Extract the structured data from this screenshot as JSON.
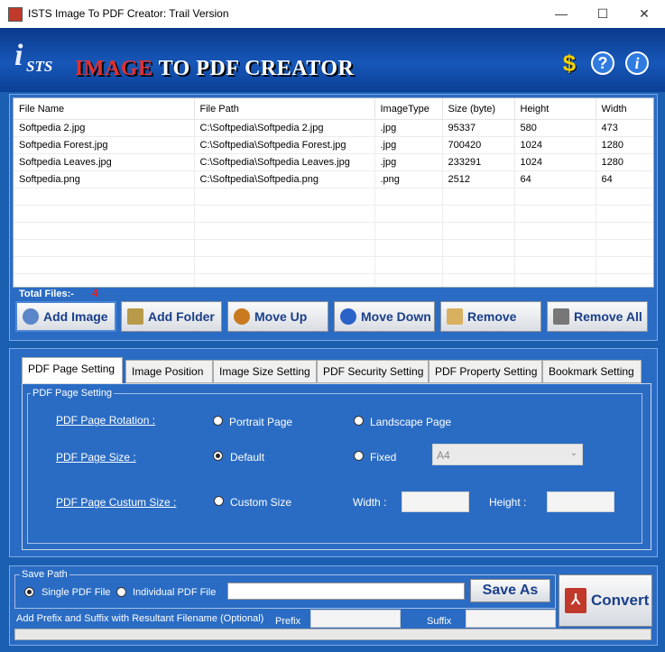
{
  "window": {
    "title": "ISTS Image To PDF Creator: Trail Version",
    "minimize": "—",
    "maximize": "☐",
    "close": "✕"
  },
  "header": {
    "logo_i": "i",
    "logo_sts": "STS",
    "logo_title_red": "IMAGE",
    "logo_title_rest": " TO PDF CREATOR",
    "icons": [
      "dollar-icon",
      "help-icon",
      "info-icon"
    ]
  },
  "file_table": {
    "columns": [
      "File Name",
      "File Path",
      "ImageType",
      "Size (byte)",
      "Height",
      "Width"
    ],
    "rows": [
      [
        "Softpedia 2.jpg",
        "C:\\Softpedia\\Softpedia 2.jpg",
        ".jpg",
        "95337",
        "580",
        "473"
      ],
      [
        "Softpedia Forest.jpg",
        "C:\\Softpedia\\Softpedia Forest.jpg",
        ".jpg",
        "700420",
        "1024",
        "1280"
      ],
      [
        "Softpedia Leaves.jpg",
        "C:\\Softpedia\\Softpedia Leaves.jpg",
        ".jpg",
        "233291",
        "1024",
        "1280"
      ],
      [
        "Softpedia.png",
        "C:\\Softpedia\\Softpedia.png",
        ".png",
        "2512",
        "64",
        "64"
      ]
    ],
    "total_label": "Total Files:-",
    "total_count": "4"
  },
  "toolbar": {
    "add_image": "Add Image",
    "add_folder": "Add Folder",
    "move_up": "Move Up",
    "move_down": "Move Down",
    "remove": "Remove",
    "remove_all": "Remove All"
  },
  "tabs": [
    "PDF Page Setting",
    "Image Position",
    "Image Size Setting",
    "PDF Security Setting",
    "PDF Property Setting",
    "Bookmark Setting"
  ],
  "page_setting": {
    "group_title": "PDF Page Setting",
    "rotation_label": "PDF Page Rotation :",
    "portrait": "Portrait Page",
    "landscape": "Landscape Page",
    "size_label": "PDF Page Size :",
    "default": "Default",
    "fixed": "Fixed",
    "fixed_value": "A4",
    "custom_label": "PDF Page Custum Size :",
    "custom_size": "Custom Size",
    "width_label": "Width :",
    "height_label": "Height :"
  },
  "save": {
    "group_title": "Save Path",
    "single": "Single PDF File",
    "individual": "Individual PDF File",
    "save_as": "Save As",
    "convert": "Convert",
    "prefix_suffix_label": "Add Prefix and Suffix with Resultant Filename (Optional)",
    "prefix_label": "Prefix",
    "suffix_label": "Suffix"
  }
}
